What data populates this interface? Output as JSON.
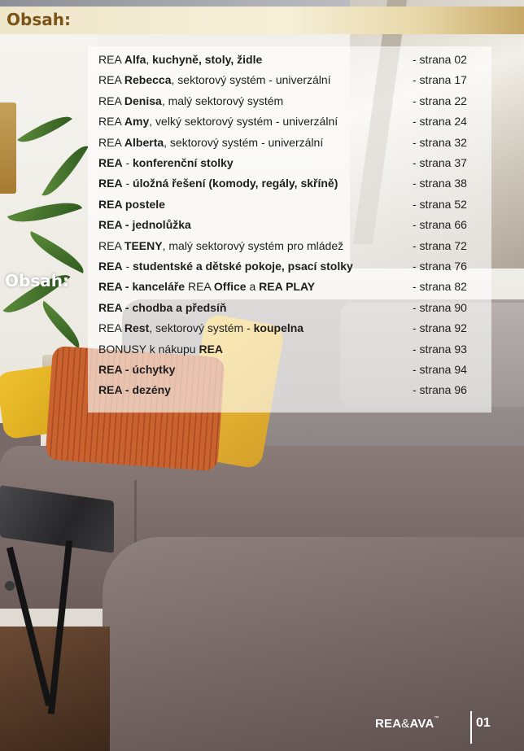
{
  "header": {
    "title": "Obsah:"
  },
  "side_label": "Obsah:",
  "toc": [
    {
      "parts": [
        [
          "REA ",
          false
        ],
        [
          "Alfa",
          true
        ],
        [
          ", ",
          false
        ],
        [
          "kuchyně, stoly, židle",
          true
        ]
      ],
      "page": "- strana 02"
    },
    {
      "parts": [
        [
          "REA ",
          false
        ],
        [
          "Rebecca",
          true
        ],
        [
          ", sektorový systém - univerzální",
          false
        ]
      ],
      "page": "- strana 17"
    },
    {
      "parts": [
        [
          "REA ",
          false
        ],
        [
          "Denisa",
          true
        ],
        [
          ", malý sektorový systém",
          false
        ]
      ],
      "page": "- strana 22"
    },
    {
      "parts": [
        [
          "REA ",
          false
        ],
        [
          "Amy",
          true
        ],
        [
          ", velký sektorový systém  - univerzální",
          false
        ]
      ],
      "page": "- strana 24"
    },
    {
      "parts": [
        [
          "REA ",
          false
        ],
        [
          "Alberta",
          true
        ],
        [
          ", sektorový systém  - univerzální",
          false
        ]
      ],
      "page": "- strana 32"
    },
    {
      "parts": [
        [
          "REA",
          true
        ],
        [
          " - ",
          false
        ],
        [
          "konferenční stolky",
          true
        ]
      ],
      "page": "- strana 37"
    },
    {
      "parts": [
        [
          "REA",
          true
        ],
        [
          " - ",
          false
        ],
        [
          "úložná řešení (komody, regály, skříně)",
          true
        ]
      ],
      "page": "- strana 38"
    },
    {
      "parts": [
        [
          "REA postele",
          true
        ]
      ],
      "page": "- strana 52"
    },
    {
      "parts": [
        [
          "REA - jednolůžka",
          true
        ]
      ],
      "page": "- strana 66"
    },
    {
      "parts": [
        [
          "REA ",
          false
        ],
        [
          "TEENY",
          true
        ],
        [
          ", malý sektorový systém pro mládež",
          false
        ]
      ],
      "page": "- strana 72"
    },
    {
      "parts": [
        [
          "REA",
          true
        ],
        [
          " - ",
          false
        ],
        [
          "studentské a dětské pokoje, psací stolky",
          true
        ]
      ],
      "page": "- strana 76"
    },
    {
      "parts": [
        [
          "REA - kanceláře",
          true
        ],
        [
          " REA ",
          false
        ],
        [
          "Office",
          true
        ],
        [
          " a ",
          false
        ],
        [
          "REA PLAY",
          true
        ]
      ],
      "page": "- strana 82"
    },
    {
      "parts": [
        [
          "REA - chodba a předsíň",
          true
        ]
      ],
      "page": "- strana 90"
    },
    {
      "parts": [
        [
          "REA ",
          false
        ],
        [
          "Rest",
          true
        ],
        [
          ", sektorový systém - ",
          false
        ],
        [
          "koupelna",
          true
        ]
      ],
      "page": "- strana 92"
    },
    {
      "parts": [
        [
          "BONUSY k nákupu ",
          false
        ],
        [
          "REA",
          true
        ]
      ],
      "page": "- strana 93"
    },
    {
      "parts": [
        [
          "REA - úchytky",
          true
        ]
      ],
      "page": "- strana 94"
    },
    {
      "parts": [
        [
          "REA - dezény",
          true
        ]
      ],
      "page": "- strana 96"
    }
  ],
  "footer": {
    "brand_rea": "REA",
    "brand_amp": "&",
    "brand_ava": "AVA",
    "brand_tm": "™",
    "page_number": "01"
  },
  "colors": {
    "title": "#7b5317",
    "panel": "#ffffff",
    "text": "#1e1e1e"
  }
}
